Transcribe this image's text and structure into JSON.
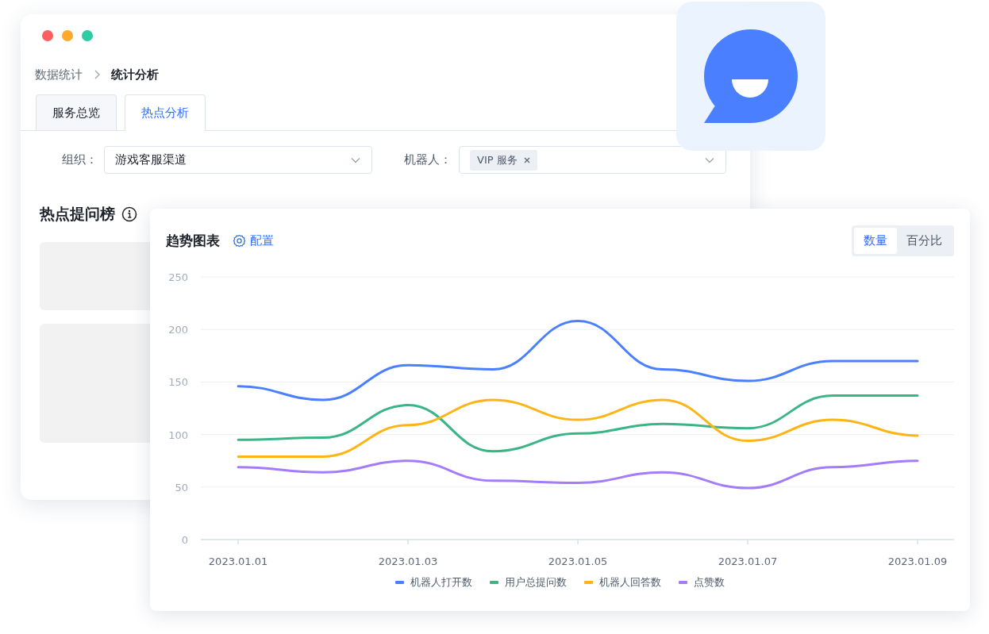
{
  "breadcrumb": [
    {
      "label": "数据统计",
      "current": false
    },
    {
      "label": "统计分析",
      "current": true
    }
  ],
  "tabs": [
    {
      "label": "服务总览",
      "selected": false
    },
    {
      "label": "热点分析",
      "selected": true
    }
  ],
  "filters": [
    {
      "label": "组织：",
      "value": "游戏客服渠道"
    },
    {
      "label": "机器人：",
      "tags": [
        "VIP 服务"
      ]
    }
  ],
  "hot_panel": {
    "title": "热点提问榜"
  },
  "trend": {
    "title": "趋势图表",
    "config_link": "配置",
    "toggle": [
      {
        "label": "数量",
        "selected": true
      },
      {
        "label": "百分比",
        "selected": false
      }
    ],
    "chart_data": {
      "type": "line",
      "categories": [
        "2023.01.01",
        null,
        "2023.01.03",
        null,
        "2023.01.05",
        null,
        "2023.01.07",
        null,
        "2023.01.09"
      ],
      "grid": true,
      "ylim": [
        0,
        250
      ],
      "yticks": [
        0,
        50,
        100,
        150,
        200,
        250
      ],
      "series": [
        {
          "name": "机器人打开数",
          "color": "#4a80ff",
          "values": [
            146,
            133,
            166,
            162,
            208,
            162,
            151,
            170,
            170
          ]
        },
        {
          "name": "用户总提问数",
          "color": "#3bb586",
          "values": [
            95,
            97,
            128,
            84,
            101,
            110,
            106,
            137,
            137
          ]
        },
        {
          "name": "机器人回答数",
          "color": "#fdb515",
          "values": [
            79,
            79,
            109,
            133,
            114,
            133,
            94,
            114,
            99
          ]
        },
        {
          "name": "点赞数",
          "color": "#a47cfa",
          "values": [
            69,
            64,
            75,
            56,
            54,
            64,
            49,
            69,
            75
          ]
        }
      ]
    }
  }
}
